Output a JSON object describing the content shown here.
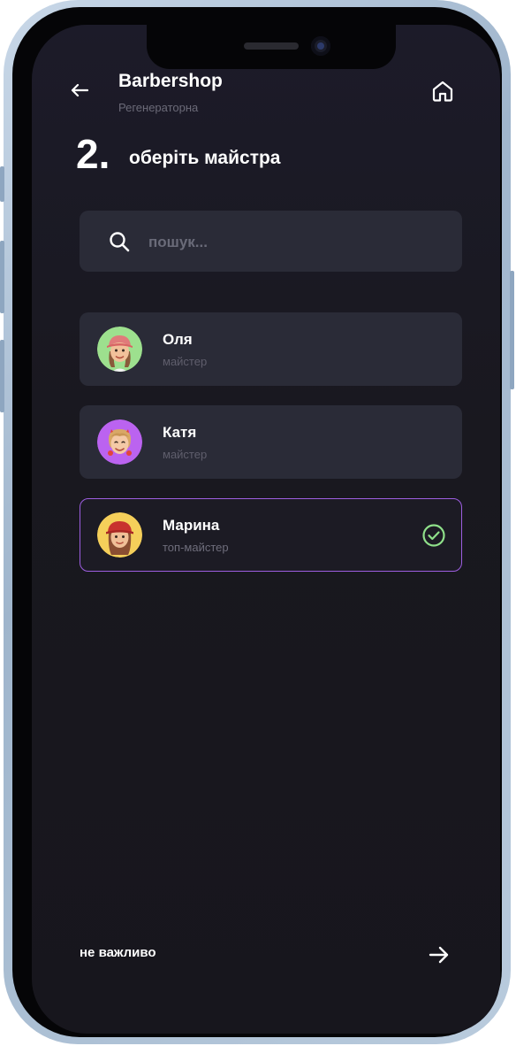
{
  "header": {
    "title": "Barbershop",
    "subtitle": "Регенераторна"
  },
  "step": {
    "number": "2.",
    "title": "оберіть майстра"
  },
  "search": {
    "placeholder": "пошук...",
    "value": ""
  },
  "masters": [
    {
      "name": "Оля",
      "role": "майстер",
      "selected": false,
      "avatar_color": "#9de08e"
    },
    {
      "name": "Катя",
      "role": "майстер",
      "selected": false,
      "avatar_color": "#bb63f0"
    },
    {
      "name": "Марина",
      "role": "топ-майстер",
      "selected": true,
      "avatar_color": "#f5cf5a"
    }
  ],
  "footer": {
    "skip_label": "не важливо"
  },
  "colors": {
    "background": "#19181f",
    "card": "#2a2b37",
    "accent_border": "#9d5ee0",
    "check": "#8fe08a",
    "muted_text": "#6b6a78"
  },
  "icons": {
    "back": "arrow-left-icon",
    "home": "home-icon",
    "search": "search-icon",
    "check": "check-circle-icon",
    "next": "arrow-right-icon"
  }
}
